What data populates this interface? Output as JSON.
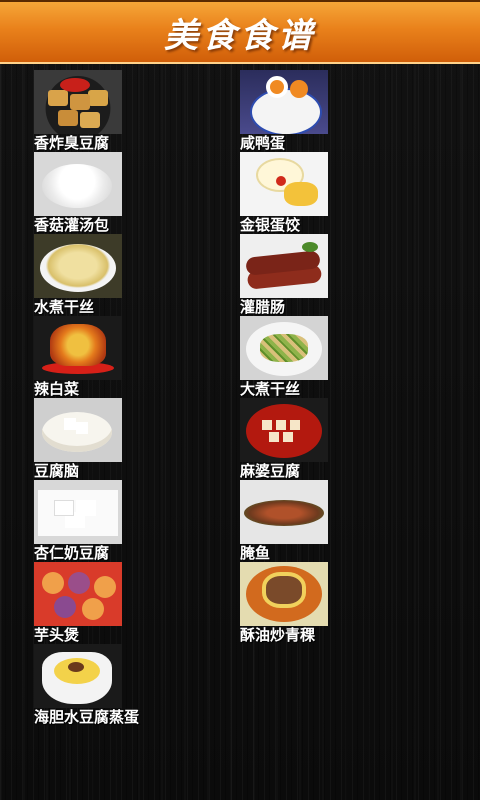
{
  "header": {
    "title": "美食食谱"
  },
  "recipes": [
    {
      "name": "香炸臭豆腐"
    },
    {
      "name": "咸鸭蛋"
    },
    {
      "name": "香菇灌汤包"
    },
    {
      "name": "金银蛋饺"
    },
    {
      "name": "水煮干丝"
    },
    {
      "name": "灌腊肠"
    },
    {
      "name": "辣白菜"
    },
    {
      "name": "大煮干丝"
    },
    {
      "name": "豆腐脑"
    },
    {
      "name": "麻婆豆腐"
    },
    {
      "name": "杏仁奶豆腐"
    },
    {
      "name": "腌鱼"
    },
    {
      "name": "芋头煲"
    },
    {
      "name": "酥油炒青稞"
    },
    {
      "name": "海胆水豆腐蒸蛋"
    }
  ],
  "colors": {
    "header_top": "#f7a93a",
    "header_bottom": "#cf5c08",
    "background": "#0e0e0e",
    "label_text": "#ffffff"
  }
}
